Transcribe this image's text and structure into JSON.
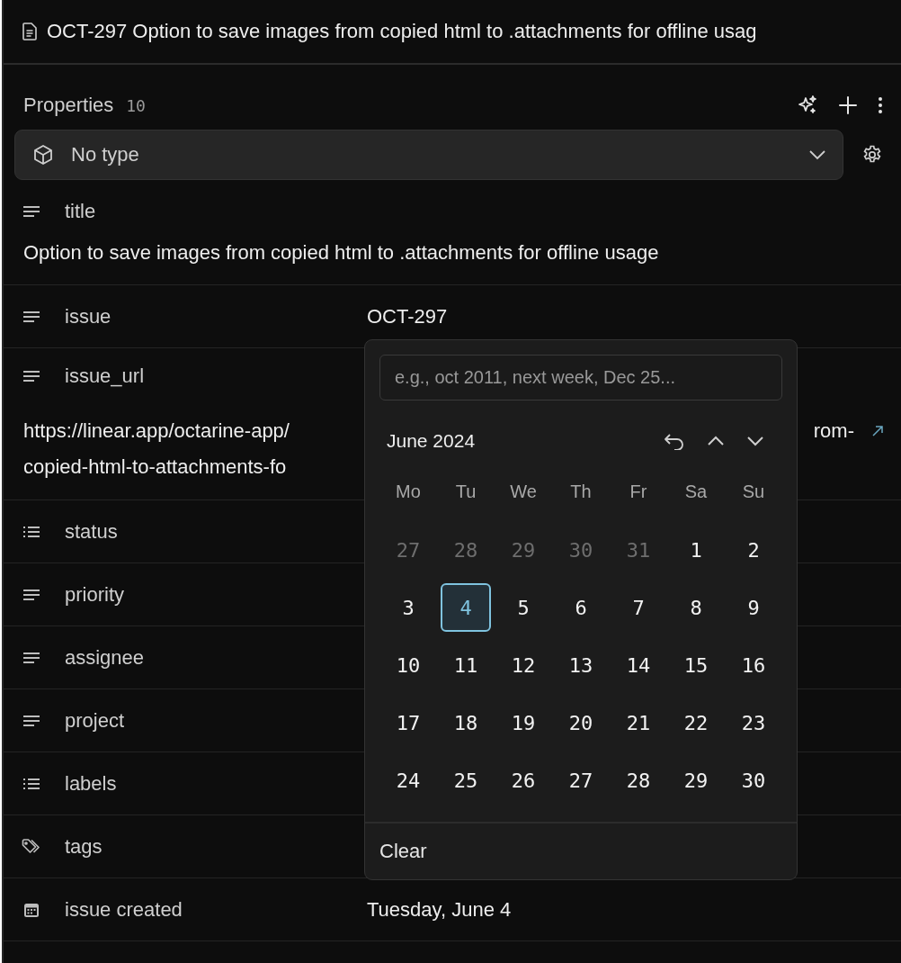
{
  "document": {
    "title": "OCT-297 Option to save images from copied html to .attachments for offline usag"
  },
  "properties": {
    "heading": "Properties",
    "count": "10",
    "type_select": {
      "value": "No type"
    },
    "rows": [
      {
        "label": "title",
        "kind": "text",
        "block_value": "Option to save images from copied html to .attachments for offline usage"
      },
      {
        "label": "issue",
        "kind": "text",
        "value": "OCT-297"
      },
      {
        "label": "issue_url",
        "kind": "text",
        "lines": [
          {
            "text": "https://linear.app/octarine-app/",
            "tail": "rom-"
          },
          {
            "text": "copied-html-to-attachments-fo"
          }
        ]
      },
      {
        "label": "status",
        "kind": "list"
      },
      {
        "label": "priority",
        "kind": "text"
      },
      {
        "label": "assignee",
        "kind": "text"
      },
      {
        "label": "project",
        "kind": "text"
      },
      {
        "label": "labels",
        "kind": "list"
      },
      {
        "label": "tags",
        "kind": "tag"
      },
      {
        "label": "issue created",
        "kind": "date",
        "value": "Tuesday, June 4"
      }
    ]
  },
  "date_picker": {
    "placeholder": "e.g., oct 2011, next week, Dec 25...",
    "month": "June 2024",
    "weekdays": [
      "Mo",
      "Tu",
      "We",
      "Th",
      "Fr",
      "Sa",
      "Su"
    ],
    "days": [
      {
        "label": "27",
        "muted": true,
        "selected": false
      },
      {
        "label": "28",
        "muted": true,
        "selected": false
      },
      {
        "label": "29",
        "muted": true,
        "selected": false
      },
      {
        "label": "30",
        "muted": true,
        "selected": false
      },
      {
        "label": "31",
        "muted": true,
        "selected": false
      },
      {
        "label": "1",
        "muted": false,
        "selected": false
      },
      {
        "label": "2",
        "muted": false,
        "selected": false
      },
      {
        "label": "3",
        "muted": false,
        "selected": false
      },
      {
        "label": "4",
        "muted": false,
        "selected": true
      },
      {
        "label": "5",
        "muted": false,
        "selected": false
      },
      {
        "label": "6",
        "muted": false,
        "selected": false
      },
      {
        "label": "7",
        "muted": false,
        "selected": false
      },
      {
        "label": "8",
        "muted": false,
        "selected": false
      },
      {
        "label": "9",
        "muted": false,
        "selected": false
      },
      {
        "label": "10",
        "muted": false,
        "selected": false
      },
      {
        "label": "11",
        "muted": false,
        "selected": false
      },
      {
        "label": "12",
        "muted": false,
        "selected": false
      },
      {
        "label": "13",
        "muted": false,
        "selected": false
      },
      {
        "label": "14",
        "muted": false,
        "selected": false
      },
      {
        "label": "15",
        "muted": false,
        "selected": false
      },
      {
        "label": "16",
        "muted": false,
        "selected": false
      },
      {
        "label": "17",
        "muted": false,
        "selected": false
      },
      {
        "label": "18",
        "muted": false,
        "selected": false
      },
      {
        "label": "19",
        "muted": false,
        "selected": false
      },
      {
        "label": "20",
        "muted": false,
        "selected": false
      },
      {
        "label": "21",
        "muted": false,
        "selected": false
      },
      {
        "label": "22",
        "muted": false,
        "selected": false
      },
      {
        "label": "23",
        "muted": false,
        "selected": false
      },
      {
        "label": "24",
        "muted": false,
        "selected": false
      },
      {
        "label": "25",
        "muted": false,
        "selected": false
      },
      {
        "label": "26",
        "muted": false,
        "selected": false
      },
      {
        "label": "27",
        "muted": false,
        "selected": false
      },
      {
        "label": "28",
        "muted": false,
        "selected": false
      },
      {
        "label": "29",
        "muted": false,
        "selected": false
      },
      {
        "label": "30",
        "muted": false,
        "selected": false
      }
    ],
    "clear": "Clear"
  }
}
